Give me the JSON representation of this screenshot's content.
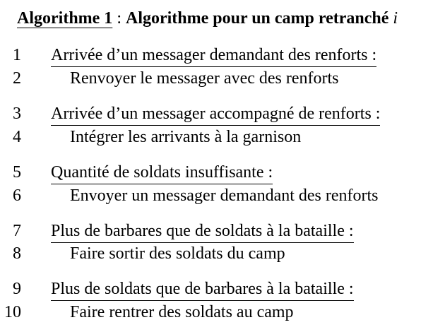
{
  "header": {
    "label": "Algorithme 1",
    "separator": " : ",
    "name": "Algorithme pour un camp retranché ",
    "variable": "i"
  },
  "steps": [
    {
      "num": "1",
      "text": "Arrivée d’un messager demandant des renforts :"
    },
    {
      "num": "2",
      "text": "Renvoyer le messager avec des renforts"
    },
    {
      "num": "3",
      "text": "Arrivée d’un messager accompagné de renforts :"
    },
    {
      "num": "4",
      "text": "Intégrer les arrivants à la garnison"
    },
    {
      "num": "5",
      "text": "Quantité de soldats insuffisante :"
    },
    {
      "num": "6",
      "text": "Envoyer un messager demandant des renforts"
    },
    {
      "num": "7",
      "text": "Plus de barbares que de soldats à la bataille :"
    },
    {
      "num": "8",
      "text": "Faire sortir des soldats du camp"
    },
    {
      "num": "9",
      "text": "Plus de soldats que de barbares à la bataille :"
    },
    {
      "num": "10",
      "text": "Faire rentrer des soldats au camp"
    }
  ]
}
